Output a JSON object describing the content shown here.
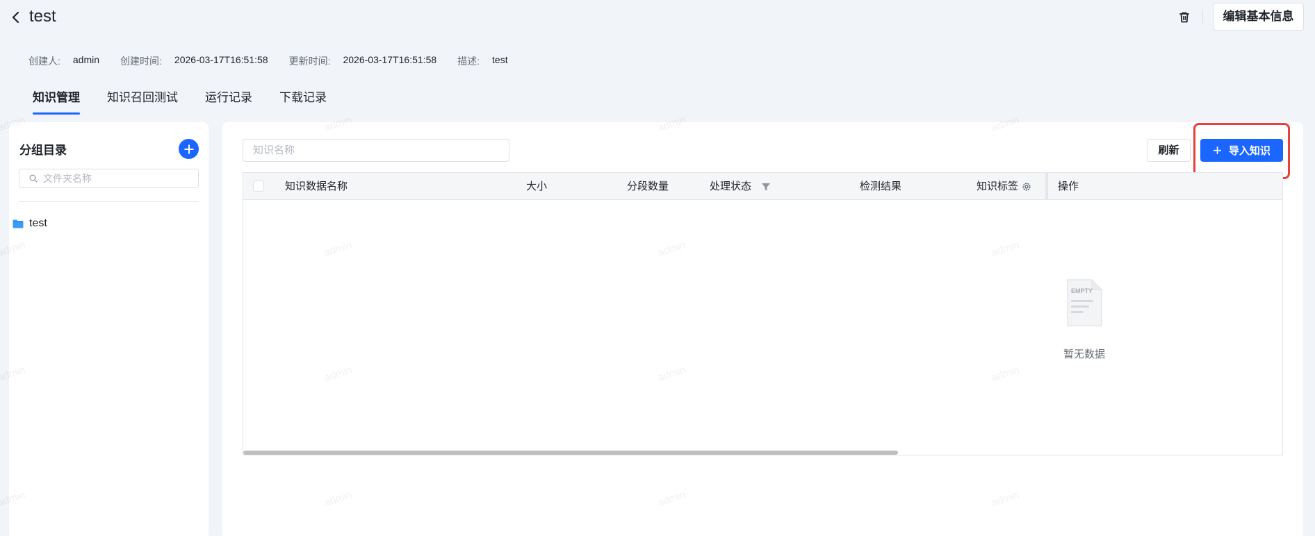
{
  "header": {
    "title": "test",
    "edit_label": "编辑基本信息"
  },
  "meta": {
    "creator_label": "创建人:",
    "creator_value": "admin",
    "created_label": "创建时间:",
    "created_value": "2026-03-17T16:51:58",
    "updated_label": "更新时间:",
    "updated_value": "2026-03-17T16:51:58",
    "desc_label": "描述:",
    "desc_value": "test"
  },
  "tabs": [
    {
      "label": "知识管理",
      "active": true
    },
    {
      "label": "知识召回测试",
      "active": false
    },
    {
      "label": "运行记录",
      "active": false
    },
    {
      "label": "下载记录",
      "active": false
    }
  ],
  "sidebar": {
    "title": "分组目录",
    "search_placeholder": "文件夹名称",
    "folders": [
      {
        "label": "test"
      }
    ]
  },
  "main": {
    "search_placeholder": "知识名称",
    "refresh_label": "刷新",
    "import_label": "导入知识",
    "columns": [
      "知识数据名称",
      "大小",
      "分段数量",
      "处理状态",
      "检测结果",
      "知识标签",
      "操作"
    ],
    "empty_label": "EMPTY",
    "empty_text": "暂无数据"
  },
  "watermark": "admin",
  "colors": {
    "accent": "#1a66ff",
    "highlight": "#e8403a"
  }
}
